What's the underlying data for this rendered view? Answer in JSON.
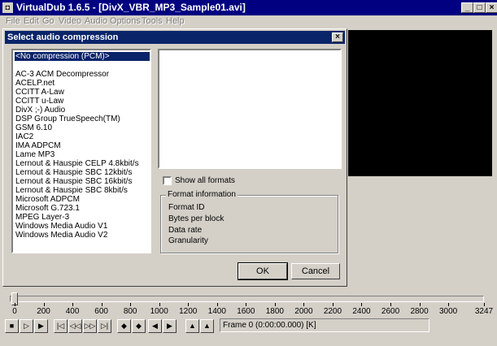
{
  "window": {
    "title": "VirtualDub 1.6.5 - [DivX_VBR_MP3_Sample01.avi]",
    "app_icon": "virtualdub-icon",
    "minimize": "_",
    "maximize": "□",
    "close": "×"
  },
  "menu": [
    "File",
    "Edit",
    "Go",
    "Video",
    "Audio",
    "Options",
    "Tools",
    "Help"
  ],
  "dialog": {
    "title": "Select audio compression",
    "close": "×",
    "codecs": [
      "<No compression (PCM)>",
      "",
      "AC-3 ACM Decompressor",
      "ACELP.net",
      "CCITT A-Law",
      "CCITT u-Law",
      "DivX ;-) Audio",
      "DSP Group TrueSpeech(TM)",
      "GSM 6.10",
      "IAC2",
      "IMA ADPCM",
      "Lame MP3",
      "Lernout & Hauspie CELP 4.8kbit/s",
      "Lernout & Hauspie SBC 12kbit/s",
      "Lernout & Hauspie SBC 16kbit/s",
      "Lernout & Hauspie SBC 8kbit/s",
      "Microsoft ADPCM",
      "Microsoft G.723.1",
      "MPEG Layer-3",
      "Windows Media Audio V1",
      "Windows Media Audio V2"
    ],
    "selected_codec": "<No compression (PCM)>",
    "show_all_formats": "Show all formats",
    "show_all_checked": false,
    "format_info": {
      "legend": "Format information",
      "fields": [
        "Format ID",
        "Bytes per block",
        "Data rate",
        "Granularity"
      ]
    },
    "ok": "OK",
    "cancel": "Cancel"
  },
  "timeline": {
    "ticks": [
      "0",
      "200",
      "400",
      "600",
      "800",
      "1000",
      "1200",
      "1400",
      "1600",
      "1800",
      "2000",
      "2200",
      "2400",
      "2600",
      "2800",
      "3000",
      "3247"
    ],
    "max_frame": 3247,
    "position_frame": 0
  },
  "toolbar": {
    "buttons": [
      "stop-icon",
      "play-input-icon",
      "play-output-icon",
      "start-icon",
      "prev-icon",
      "next-icon",
      "end-icon",
      "prev-keyframe-icon",
      "next-keyframe-icon",
      "scene-back-icon",
      "scene-forward-icon",
      "mark-in-icon",
      "mark-out-icon"
    ],
    "frame_info": "Frame 0 (0:00:00.000) [K]"
  }
}
